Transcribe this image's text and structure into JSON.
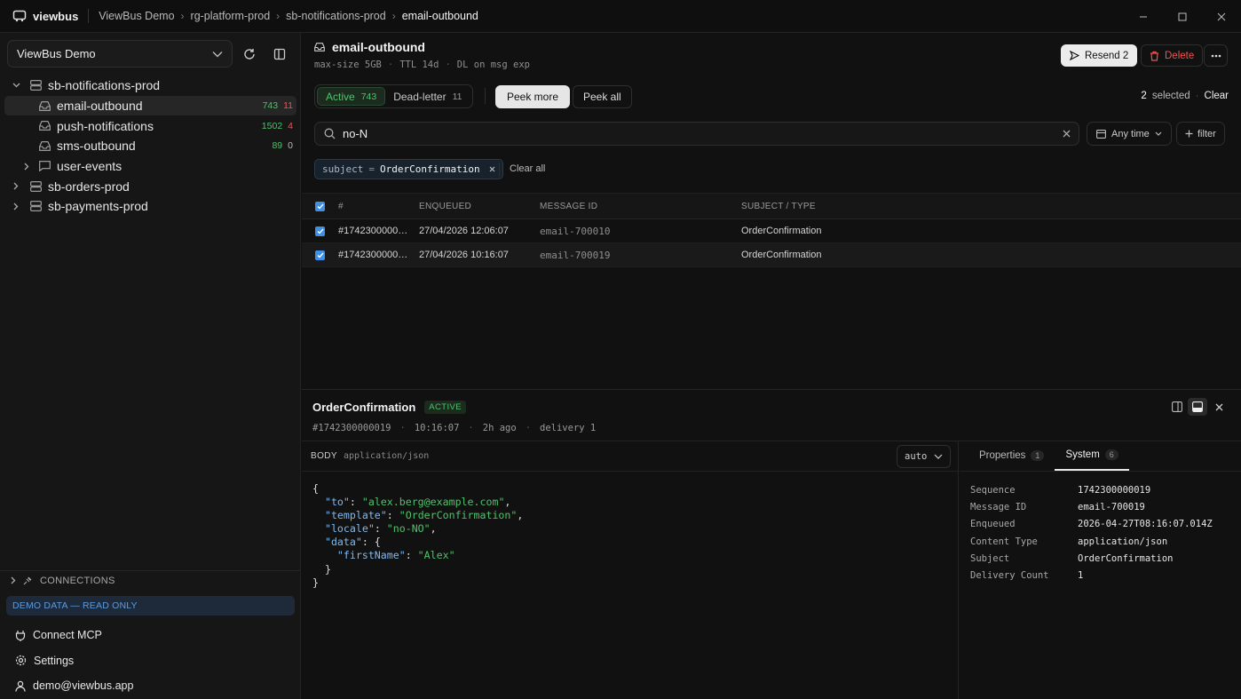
{
  "app": {
    "logo_text": "viewbus",
    "workspace": "ViewBus Demo"
  },
  "breadcrumb": [
    "ViewBus Demo",
    "rg-platform-prod",
    "sb-notifications-prod",
    "email-outbound"
  ],
  "sidebar": {
    "workspace_select": "ViewBus Demo",
    "tree": [
      {
        "label": "sb-notifications-prod",
        "type": "namespace",
        "expanded": true
      },
      {
        "label": "email-outbound",
        "type": "queue",
        "active": "743",
        "dead": "11",
        "selected": true
      },
      {
        "label": "push-notifications",
        "type": "queue",
        "active": "1502",
        "dead": "4"
      },
      {
        "label": "sms-outbound",
        "type": "queue",
        "active": "89",
        "dead": "0"
      },
      {
        "label": "user-events",
        "type": "topic"
      },
      {
        "label": "sb-orders-prod",
        "type": "namespace"
      },
      {
        "label": "sb-payments-prod",
        "type": "namespace"
      }
    ],
    "connections_label": "CONNECTIONS",
    "demo_badge": "DEMO DATA — READ ONLY",
    "footer": {
      "connect": "Connect MCP",
      "settings": "Settings",
      "user": "demo@viewbus.app"
    }
  },
  "queue": {
    "name": "email-outbound",
    "meta": [
      "max-size 5GB",
      "TTL 14d",
      "DL on msg exp"
    ],
    "resend_label": "Resend 2",
    "delete_label": "Delete",
    "tabs": {
      "active_label": "Active",
      "active_count": "743",
      "dead_label": "Dead-letter",
      "dead_count": "11"
    },
    "peek_more": "Peek more",
    "peek_all": "Peek all",
    "selected_count": "2",
    "selected_label": "selected",
    "clear": "Clear"
  },
  "search": {
    "value": "no-N",
    "time_filter": "Any time",
    "add_filter": "filter"
  },
  "chips": {
    "key": "subject",
    "op": "=",
    "value": "OrderConfirmation",
    "clear_all": "Clear all"
  },
  "table": {
    "headers": [
      "#",
      "ENQUEUED",
      "MESSAGE ID",
      "SUBJECT / TYPE"
    ],
    "rows": [
      {
        "seq": "#1742300000…",
        "enqueued": "27/04/2026 12:06:07",
        "message_id": "email-700010",
        "subject": "OrderConfirmation"
      },
      {
        "seq": "#1742300000…",
        "enqueued": "27/04/2026 10:16:07",
        "message_id": "email-700019",
        "subject": "OrderConfirmation"
      }
    ]
  },
  "detail": {
    "title": "OrderConfirmation",
    "state": "ACTIVE",
    "meta": [
      "#1742300000019",
      "10:16:07",
      "2h ago",
      "delivery 1"
    ],
    "body_label": "BODY",
    "content_type": "application/json",
    "format": "auto",
    "json": {
      "to": "alex.berg@example.com",
      "template": "OrderConfirmation",
      "locale": "no-NO",
      "firstName": "Alex"
    },
    "tabs": {
      "properties_label": "Properties",
      "properties_count": "1",
      "system_label": "System",
      "system_count": "6"
    },
    "system": [
      {
        "k": "Sequence",
        "v": "1742300000019"
      },
      {
        "k": "Message ID",
        "v": "email-700019"
      },
      {
        "k": "Enqueued",
        "v": "2026-04-27T08:16:07.014Z"
      },
      {
        "k": "Content Type",
        "v": "application/json"
      },
      {
        "k": "Subject",
        "v": "OrderConfirmation"
      },
      {
        "k": "Delivery Count",
        "v": "1"
      }
    ]
  },
  "colors": {
    "accent_green": "#4ec36a",
    "accent_red": "#ef5350",
    "accent_blue": "#3d8fe8",
    "bg": "#111111"
  }
}
